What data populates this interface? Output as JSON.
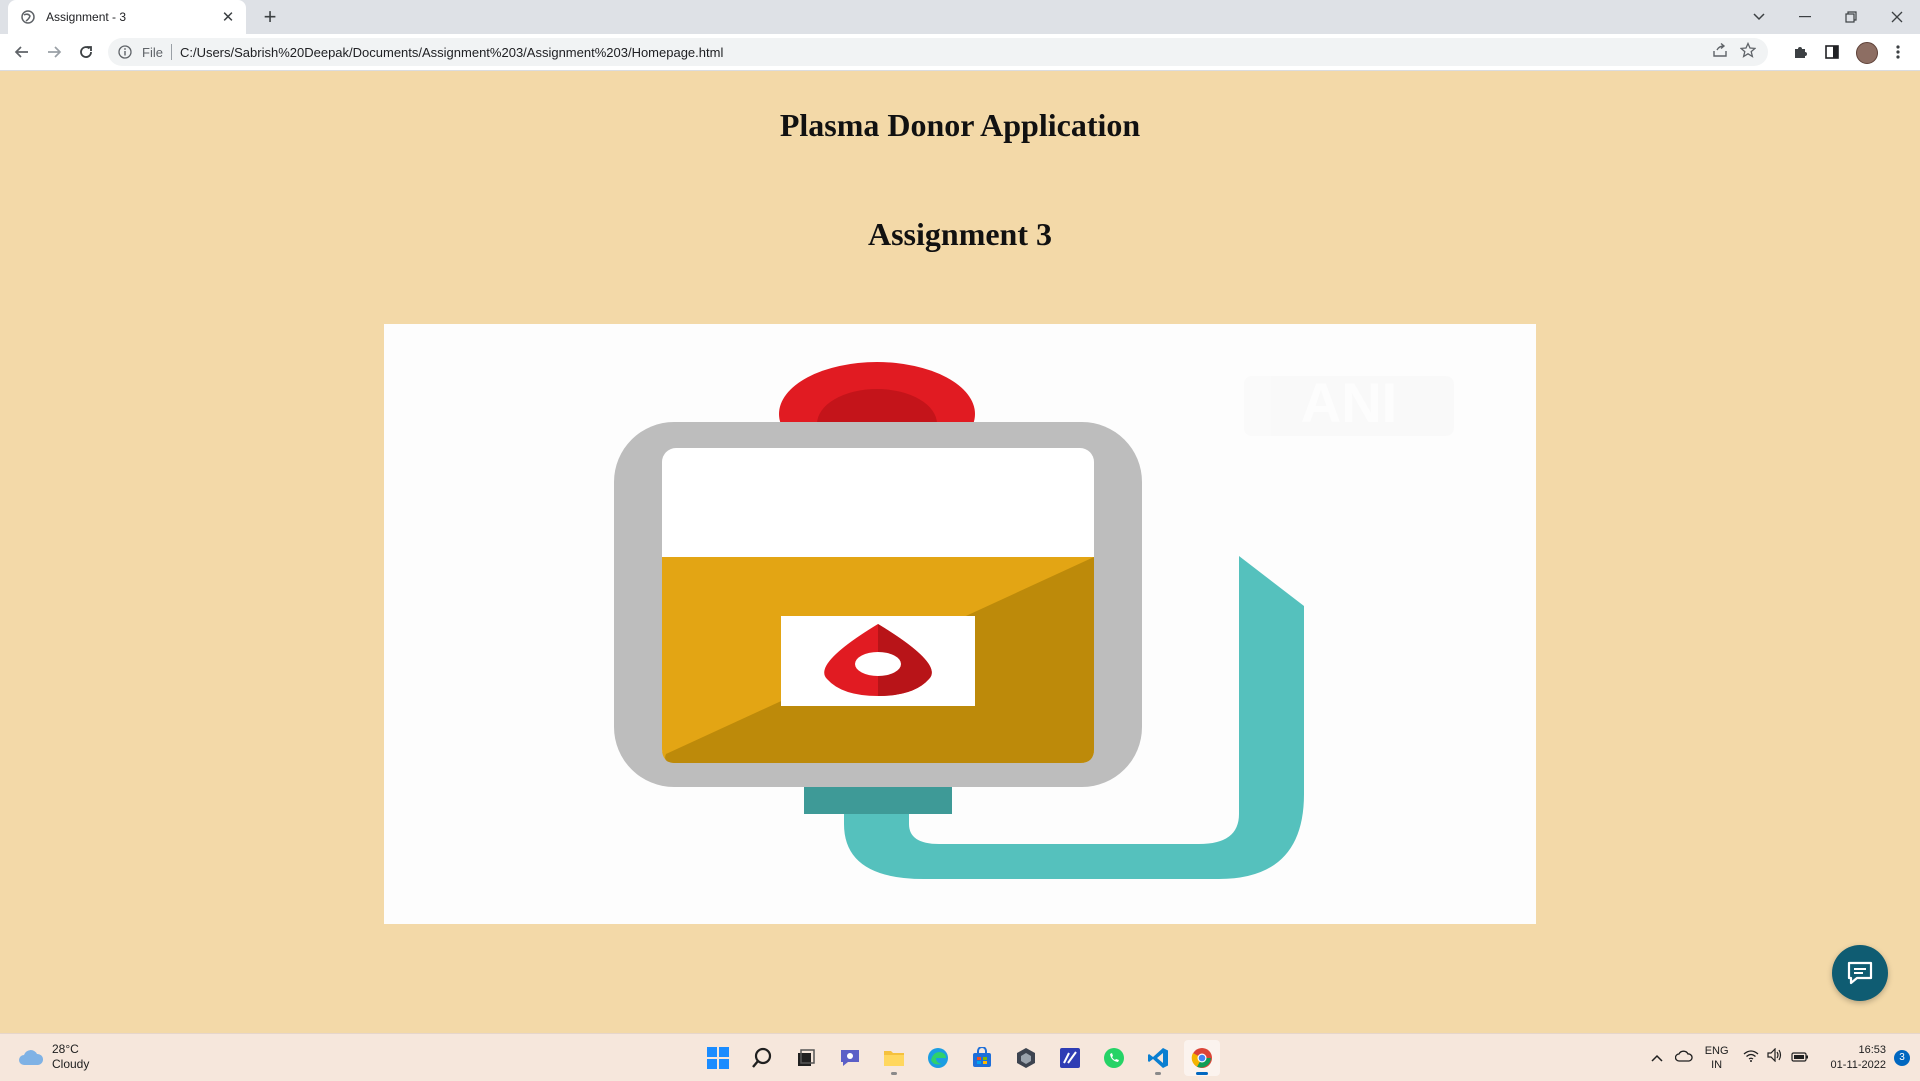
{
  "browser": {
    "tab_title": "Assignment - 3",
    "address_scheme_label": "File",
    "url": "C:/Users/Sabrish%20Deepak/Documents/Assignment%203/Assignment%203/Homepage.html"
  },
  "page": {
    "app_title": "Plasma Donor Application",
    "assignment_title": "Assignment 3",
    "hero_image": "plasma-bag-illustration",
    "watermark": "ANI"
  },
  "taskbar": {
    "weather_temp": "28°C",
    "weather_desc": "Cloudy",
    "apps": [
      "start-icon",
      "search-icon",
      "task-view-icon",
      "chat-icon",
      "file-explorer-icon",
      "edge-icon",
      "store-icon",
      "app-icon",
      "notes-icon",
      "whatsapp-icon",
      "vscode-icon",
      "chrome-icon"
    ],
    "lang_top": "ENG",
    "lang_bottom": "IN",
    "time": "16:53",
    "date": "01-11-2022",
    "notification_count": "3"
  },
  "colors": {
    "page_bg": "#f3d9a8",
    "plasma": "#e3a514",
    "blood_red": "#e11b22",
    "tube_teal": "#55c1bd",
    "chat_fab": "#0f5c72"
  }
}
